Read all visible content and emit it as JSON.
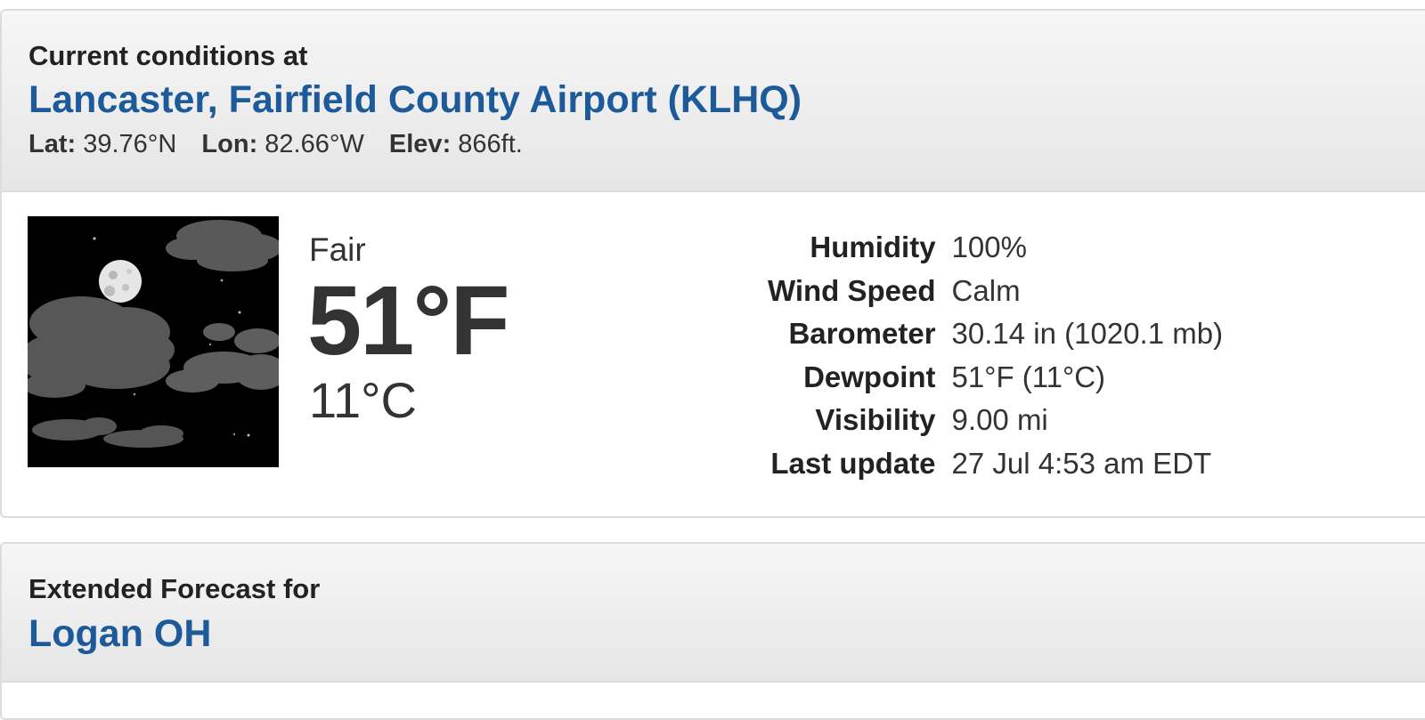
{
  "current": {
    "subheading": "Current conditions at",
    "station": "Lancaster, Fairfield County Airport (KLHQ)",
    "coords": {
      "lat_label": "Lat:",
      "lat": "39.76°N",
      "lon_label": "Lon:",
      "lon": "82.66°W",
      "elev_label": "Elev:",
      "elev": "866ft."
    },
    "icon": "night-partly-cloudy-moon-icon",
    "condition": "Fair",
    "temp_f": "51°F",
    "temp_c": "11°C",
    "details": [
      {
        "label": "Humidity",
        "value": "100%"
      },
      {
        "label": "Wind Speed",
        "value": "Calm"
      },
      {
        "label": "Barometer",
        "value": "30.14 in (1020.1 mb)"
      },
      {
        "label": "Dewpoint",
        "value": "51°F (11°C)"
      },
      {
        "label": "Visibility",
        "value": "9.00 mi"
      },
      {
        "label": "Last update",
        "value": "27 Jul 4:53 am EDT"
      }
    ]
  },
  "forecast": {
    "subheading": "Extended Forecast for",
    "location": "Logan OH"
  },
  "colors": {
    "title_blue": "#1c5a99",
    "heading_bg": "#ececec",
    "border": "#dcdcdc"
  }
}
